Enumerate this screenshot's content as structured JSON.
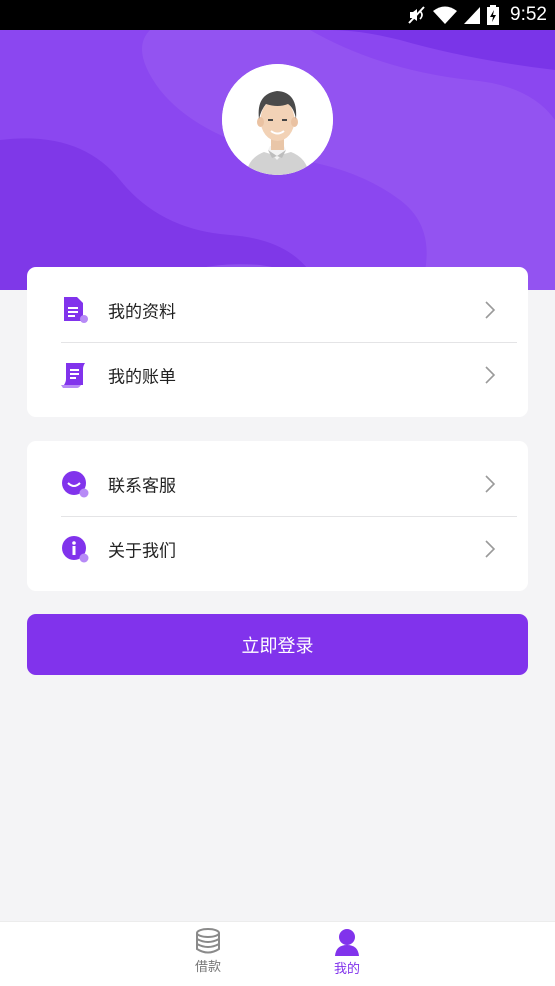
{
  "status_bar": {
    "time": "9:52",
    "icons": [
      "mute-icon",
      "wifi-icon",
      "signal-icon",
      "battery-icon"
    ]
  },
  "colors": {
    "accent": "#8133ec",
    "header": "#8a46f0",
    "background": "#f4f4f6"
  },
  "profile": {
    "avatar_icon": "user-avatar-icon"
  },
  "menu_group_1": [
    {
      "label": "我的资料",
      "icon": "document-icon"
    },
    {
      "label": "我的账单",
      "icon": "bill-icon"
    }
  ],
  "menu_group_2": [
    {
      "label": "联系客服",
      "icon": "chat-bubble-icon"
    },
    {
      "label": "关于我们",
      "icon": "info-icon"
    }
  ],
  "login_button": {
    "label": "立即登录"
  },
  "tabbar": [
    {
      "label": "借款",
      "icon": "coins-icon",
      "active": false
    },
    {
      "label": "我的",
      "icon": "person-icon",
      "active": true
    }
  ]
}
